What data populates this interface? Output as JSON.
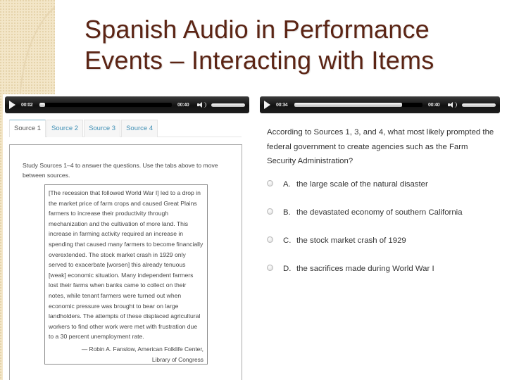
{
  "slide": {
    "title_line1": "Spanish Audio in Performance",
    "title_line2": "Events – Interacting with Items",
    "title_color": "#5b2414"
  },
  "audio_left": {
    "current_time": "00:02",
    "duration": "00:40",
    "progress": 0.04,
    "volume": 1.0
  },
  "audio_right": {
    "current_time": "00:34",
    "duration": "00:40",
    "progress": 0.84,
    "volume": 1.0
  },
  "tabs": [
    {
      "label": "Source 1",
      "active": true
    },
    {
      "label": "Source 2",
      "active": false
    },
    {
      "label": "Source 3",
      "active": false
    },
    {
      "label": "Source 4",
      "active": false
    }
  ],
  "source_panel": {
    "instructions": "Study Sources 1–4 to answer the questions. Use the tabs above to move between sources.",
    "quote": "[The recession that followed World War I] led to a drop in the market price of farm crops and caused Great Plains farmers to increase their productivity through mechanization and the cultivation of more land. This increase in farming activity required an increase in spending that caused many farmers to become financially overextended. The stock market crash in 1929 only served to exacerbate [worsen] this already tenuous [weak] economic situation. Many independent farmers lost their farms when banks came to collect on their notes, while tenant farmers were turned out when economic pressure was brought to bear on large landholders. The attempts of these displaced agricultural workers to find other work were met with frustration due to a 30 percent unemployment rate.",
    "attribution_line1": "— Robin A. Fanslow, American Folklife Center,",
    "attribution_line2": "Library of Congress"
  },
  "question": {
    "text": "According to Sources 1, 3, and 4, what most likely prompted the federal government to create agencies such as the Farm Security Administration?",
    "options": [
      {
        "letter": "A.",
        "text": "the large scale of the natural disaster",
        "selected": false
      },
      {
        "letter": "B.",
        "text": "the devastated economy of southern California",
        "selected": false
      },
      {
        "letter": "C.",
        "text": "the stock market crash of 1929",
        "selected": false
      },
      {
        "letter": "D.",
        "text": "the sacrifices made during World War I",
        "selected": false
      }
    ]
  },
  "colors": {
    "tab_link": "#3e8fb5",
    "player_bg": "#1e1e1e",
    "deco_bg": "#f3e6c8"
  },
  "icons": {
    "play": "play-icon",
    "volume": "volume-icon",
    "radio": "radio-button-icon"
  }
}
